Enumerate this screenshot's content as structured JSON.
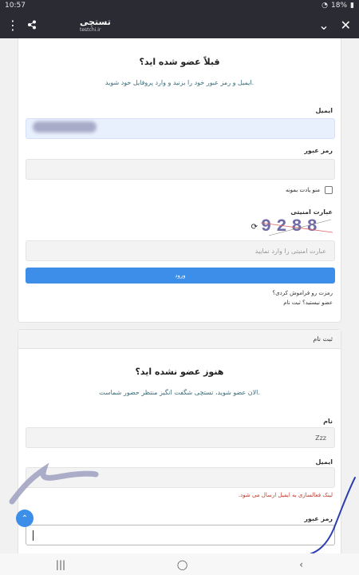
{
  "status": {
    "time": "10:57",
    "battery": "18%"
  },
  "tabbar": {
    "title": "تستچی",
    "subtitle": "testchi.ir"
  },
  "login": {
    "heading": "قبلاً عضو شده اید؟",
    "subheading": "ایمیل و رمز عبور خود را بزنید و وارد پروفایل خود شوید.",
    "email_label": "ایمیل",
    "password_label": "رمز عبور",
    "remember_label": "منو یادت بمونه",
    "captcha_label": "عبارت امنیتی",
    "captcha_text": "9288",
    "captcha_placeholder": "عبارت امنیتی را وارد نمایید",
    "submit_label": "ورود",
    "forgot_link": "رمزت رو فراموش کردی؟",
    "register_link": "عضو نیستید؟ ثبت نام"
  },
  "register": {
    "tab_label": "ثبت نام",
    "heading": "هنوز عضو نشده اید؟",
    "subheading": "الان عضو شوید، تستچی شگفت انگیز منتظر حضور شماست.",
    "name_label": "نام",
    "name_value": "Zzz",
    "email_label": "ایمیل",
    "email_hint": "لینک فعالسازی به ایمیل ارسال می شود.",
    "password_label": "رمز عبور"
  },
  "colors": {
    "accent": "#3d8ee8",
    "topbar": "#2b2b33"
  }
}
